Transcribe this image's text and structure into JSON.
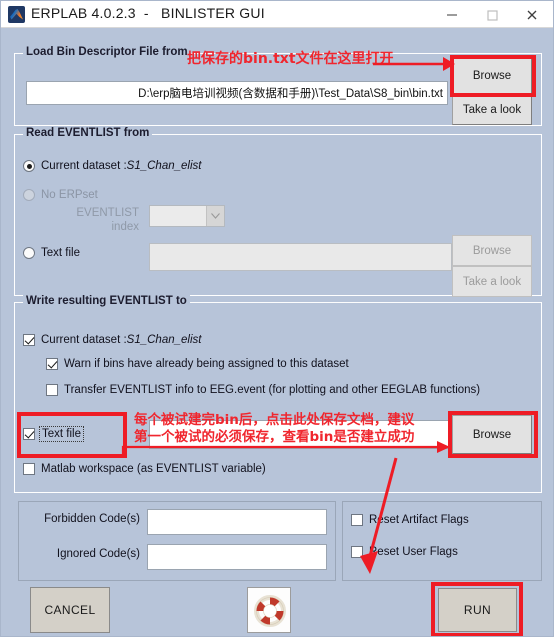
{
  "window": {
    "title": "ERPLAB 4.0.2.3  -   BINLISTER GUI",
    "icon": "matlab-logo-icon",
    "controls": {
      "minimize": "minimize-icon",
      "maximize": "maximize-icon",
      "close": "close-icon"
    },
    "background_color": "#b7c4d9"
  },
  "panel_load": {
    "title": "Load Bin Descriptor File from",
    "path_value": "D:\\erp脑电培训视频(含数据和手册)\\Test_Data\\S8_bin\\bin.txt",
    "browse_label": "Browse",
    "take_a_look_label": "Take a look"
  },
  "panel_read": {
    "title": "Read EVENTLIST from",
    "current_dataset_label": "Current dataset :",
    "current_dataset_value": "S1_Chan_elist",
    "no_erpset_label": "No ERPset",
    "eventlist_index_label_line1": "EVENTLIST",
    "eventlist_index_label_line2": "index",
    "eventlist_index_value": "",
    "text_file_label": "Text file",
    "text_file_value": "",
    "browse_label": "Browse",
    "take_a_look_label": "Take a look"
  },
  "panel_write": {
    "title": "Write resulting EVENTLIST to",
    "current_dataset_label": "Current dataset :",
    "current_dataset_value": "S1_Chan_elist",
    "warn_label": "Warn if bins have already being assigned to this dataset",
    "transfer_label": "Transfer EVENTLIST info to EEG.event (for plotting and other EEGLAB functions)",
    "text_file_label": "Text file",
    "text_file_value": "",
    "browse_label": "Browse",
    "matlab_workspace_label": "Matlab workspace (as EVENTLIST variable)"
  },
  "panel_codes": {
    "forbidden_label": "Forbidden Code(s)",
    "forbidden_value": "",
    "ignored_label": "Ignored Code(s)",
    "ignored_value": ""
  },
  "panel_flags": {
    "reset_artifact_label": "Reset Artifact Flags",
    "reset_user_label": "Reset User Flags"
  },
  "footer": {
    "cancel_label": "CANCEL",
    "help_icon": "life-preserver-icon",
    "run_label": "RUN"
  },
  "annotations": {
    "color": "#ee1c25",
    "top_note": "把保存的bin.txt文件在这里打开",
    "mid_note_line1": "每个被试建完bin后，点击此处保存文档，建议",
    "mid_note_line2": "第一个被试的必须保存，查看bin是否建立成功"
  }
}
